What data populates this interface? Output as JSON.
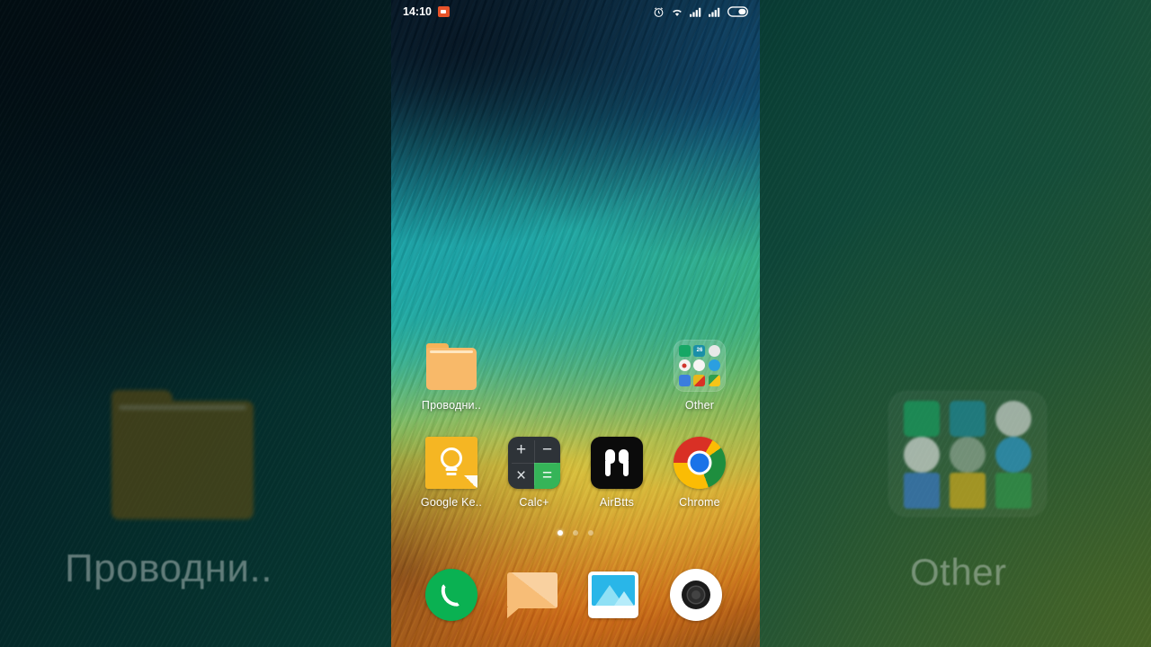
{
  "status_bar": {
    "time": "14:10",
    "notification_icon": "screen-record-icon",
    "icons": [
      "alarm-icon",
      "wifi-icon",
      "signal-sim1-icon",
      "signal-sim2-icon",
      "battery-icon"
    ]
  },
  "home_screen": {
    "row1": [
      {
        "label": "Проводни..",
        "icon": "folder-icon"
      },
      {
        "label": "Other",
        "icon": "app-folder-icon"
      }
    ],
    "row2": [
      {
        "label": "Google Ke..",
        "icon": "google-keep-icon"
      },
      {
        "label": "Calc+",
        "icon": "calculator-icon"
      },
      {
        "label": "AirBtts",
        "icon": "airpods-icon"
      },
      {
        "label": "Chrome",
        "icon": "chrome-icon"
      }
    ],
    "other_folder_apps": [
      {
        "name": "security-shield-icon",
        "color": "#16a765"
      },
      {
        "name": "calendar-icon",
        "label": "26",
        "color": "#1a8fa8"
      },
      {
        "name": "clock-icon",
        "color": "#e4e4e4"
      },
      {
        "name": "recorder-icon",
        "color": "#f0efee"
      },
      {
        "name": "compass-fitness-icon",
        "color": "#f5f4f2"
      },
      {
        "name": "blue-app-icon",
        "color": "#2b9fe0"
      },
      {
        "name": "google-translate-icon",
        "color": "#3b7ddd"
      },
      {
        "name": "google-photos-icon",
        "color": "#e8b71a"
      },
      {
        "name": "google-drive-icon",
        "color": "#2f9e4f"
      }
    ],
    "page_indicator": {
      "total": 3,
      "active": 1
    }
  },
  "dock": [
    {
      "label": "phone-icon",
      "name": "Phone"
    },
    {
      "label": "messages-icon",
      "name": "Messages"
    },
    {
      "label": "gallery-icon",
      "name": "Gallery"
    },
    {
      "label": "camera-icon",
      "name": "Camera"
    }
  ],
  "background_preview": {
    "left_label": "Проводни..",
    "right_label": "Other"
  },
  "theme": {
    "accent": "#f8b969",
    "folder_color": "#f8b969",
    "keep_yellow": "#f5b623",
    "chrome_blue": "#1a73e8",
    "phone_green": "#0ab152",
    "calc_green": "#35b458"
  }
}
